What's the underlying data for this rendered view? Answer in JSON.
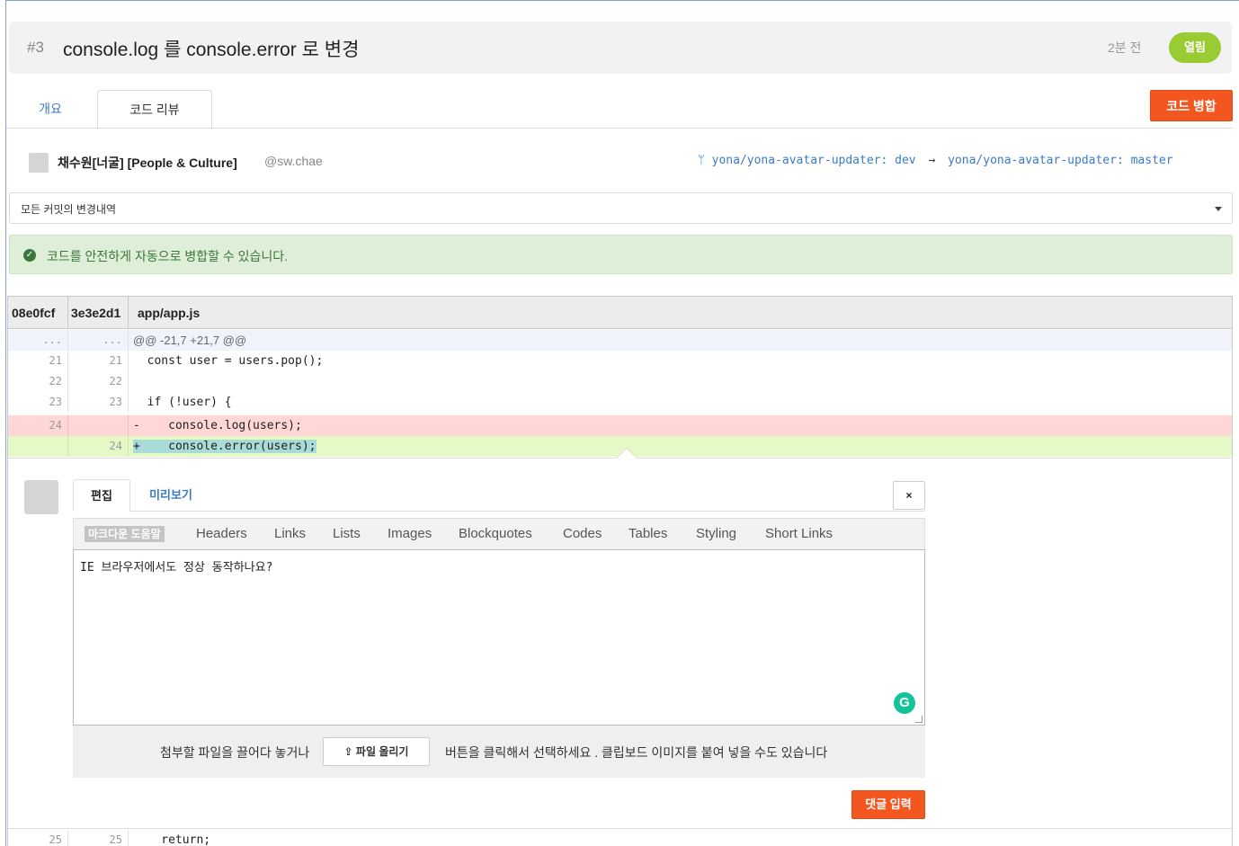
{
  "header": {
    "issue_number": "#3",
    "title": "console.log 를 console.error 로 변경",
    "time_ago": "2분 전",
    "state": "열림",
    "state_color": "#99cc33"
  },
  "tabs": {
    "overview": "개요",
    "code_review": "코드 리뷰",
    "active": "코드 리뷰"
  },
  "merge_button": "코드 병합",
  "author": {
    "name": "채수원[너굴] [People & Culture]",
    "handle": "@sw.chae"
  },
  "branch": {
    "icon": "branch-icon",
    "from": "yona/yona-avatar-updater: dev",
    "arrow": "→",
    "to": "yona/yona-avatar-updater: master"
  },
  "commit_select": {
    "selected": "모든 커밋의 변경내역"
  },
  "merge_status": {
    "icon": "check-circle-icon",
    "text": "코드를 안전하게 자동으로 병합할 수 있습니다."
  },
  "diff": {
    "commit_a": "08e0fcf",
    "commit_b": "3e3e2d1",
    "file": "app/app.js",
    "lines": [
      {
        "type": "hunk",
        "old": "...",
        "new": "...",
        "code": "@@ -21,7 +21,7 @@"
      },
      {
        "type": "ctx",
        "old": "21",
        "new": "21",
        "code": "  const user = users.pop();"
      },
      {
        "type": "ctx",
        "old": "22",
        "new": "22",
        "code": ""
      },
      {
        "type": "ctx",
        "old": "23",
        "new": "23",
        "code": "  if (!user) {"
      },
      {
        "type": "del",
        "old": "24",
        "new": "",
        "code": "-    console.log(users);"
      },
      {
        "type": "add",
        "old": "",
        "new": "24",
        "code": "+    console.error(users);"
      }
    ],
    "trailing_line": {
      "old": "25",
      "new": "25",
      "code": "    return;"
    }
  },
  "comment": {
    "tab_edit": "편집",
    "tab_preview": "미리보기",
    "close": "×",
    "toolbar": {
      "help": "마크다운 도움말",
      "items": [
        "Headers",
        "Links",
        "Lists",
        "Images",
        "Blockquotes",
        "Codes",
        "Tables",
        "Styling",
        "Short Links"
      ]
    },
    "text": "IE 브라우저에서도 정상 동작하나요?",
    "upload": {
      "text_before": "첨부할 파일을 끌어다 놓거나",
      "button": "파일 올리기",
      "text_after": "버튼을 클릭해서 선택하세요 . 클립보드 이미지를 붙여 넣을 수도 있습니다"
    },
    "submit": "댓글 입력"
  }
}
